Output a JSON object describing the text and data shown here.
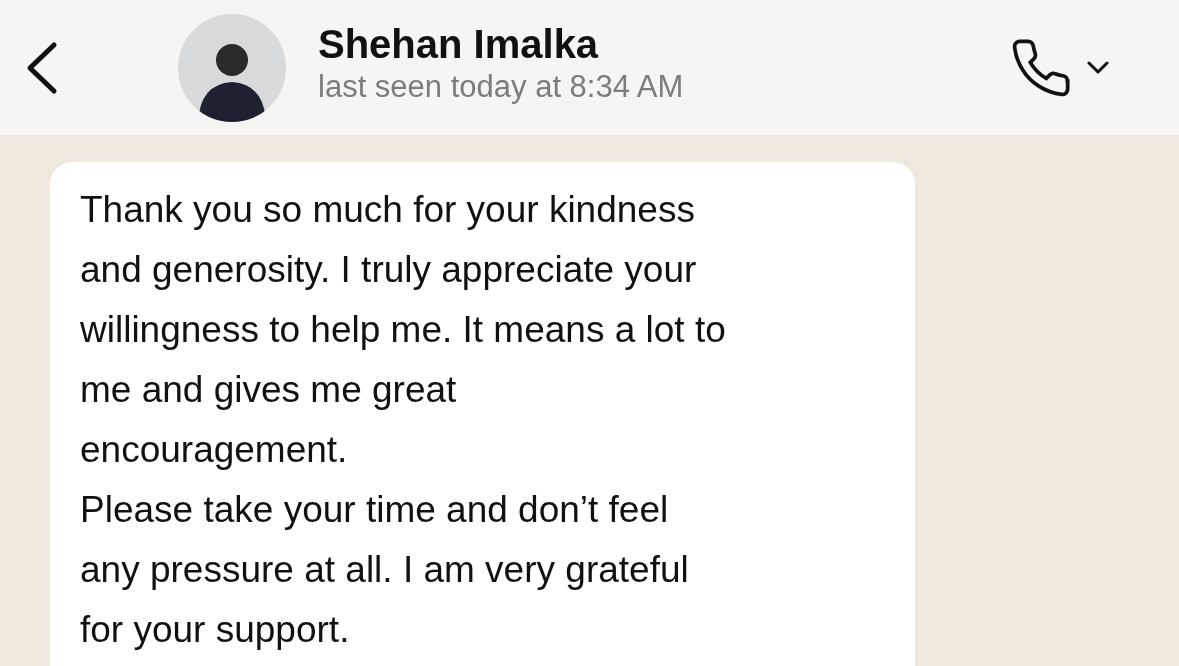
{
  "header": {
    "name": "Shehan Imalka",
    "status": "last seen today at 8:34 AM"
  },
  "messages": [
    {
      "kind": "incoming",
      "lines": [
        "Thank you so much for your kindness",
        "and generosity. I truly appreciate your",
        "willingness to help me. It means a lot to",
        "me and gives me great",
        "encouragement.",
        "Please take your time and don’t feel",
        "any pressure at all. I am very grateful",
        "for your support."
      ]
    }
  ]
}
